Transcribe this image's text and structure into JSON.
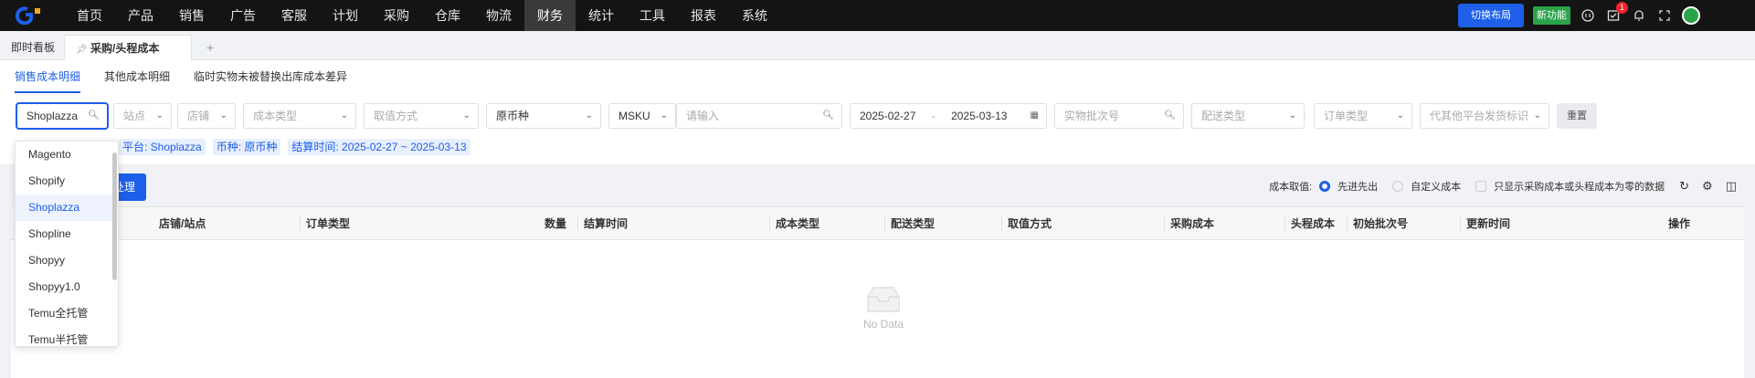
{
  "nav": {
    "items": [
      "首页",
      "产品",
      "销售",
      "广告",
      "客服",
      "计划",
      "采购",
      "仓库",
      "物流",
      "财务",
      "统计",
      "工具",
      "报表",
      "系统"
    ],
    "active": "财务",
    "switch_layout": "切换布局",
    "new_feature": "新功能",
    "notification_count": "1"
  },
  "tabs": {
    "dashboard": "即时看板",
    "current": "采购/头程成本",
    "add": "+"
  },
  "subtabs": [
    "销售成本明细",
    "其他成本明细",
    "临时实物未被替换出库成本差异"
  ],
  "filters": {
    "platform_value": "Shoplazza",
    "site_placeholder": "站点",
    "shop_placeholder": "店铺",
    "cost_type_placeholder": "成本类型",
    "value_method_placeholder": "取值方式",
    "currency_value": "原币种",
    "sku_type": "MSKU",
    "sku_placeholder": "请输入",
    "date_start": "2025-02-27",
    "date_sep": "-",
    "date_end": "2025-03-13",
    "batch_placeholder": "实物批次号",
    "delivery_placeholder": "配送类型",
    "order_type_placeholder": "订单类型",
    "proxy_placeholder": "代其他平台发货标识",
    "reset": "重置"
  },
  "tags": [
    "平台: Shoplazza",
    "币种: 原币种",
    "结算时间: 2025-02-27 ~ 2025-03-13"
  ],
  "toolbar": {
    "process_label": "处理",
    "cost_value_label": "成本取值:",
    "option_fifo": "先进先出",
    "option_custom": "自定义成本",
    "only_zero_label": "只显示采购成本或头程成本为零的数据"
  },
  "table": {
    "headers": [
      "店铺/站点",
      "订单类型",
      "数量",
      "结算时间",
      "成本类型",
      "配送类型",
      "取值方式",
      "采购成本",
      "头程成本",
      "初始批次号",
      "更新时间",
      "操作"
    ],
    "empty_text": "No Data"
  },
  "dropdown": {
    "options": [
      "Magento",
      "Shopify",
      "Shoplazza",
      "Shopline",
      "Shopyy",
      "Shopyy1.0",
      "Temu全托管",
      "Temu半托管"
    ],
    "selected": "Shoplazza"
  },
  "colors": {
    "primary": "#1d5fe8",
    "nav_bg": "#141414",
    "new_badge": "#2ba34b"
  }
}
